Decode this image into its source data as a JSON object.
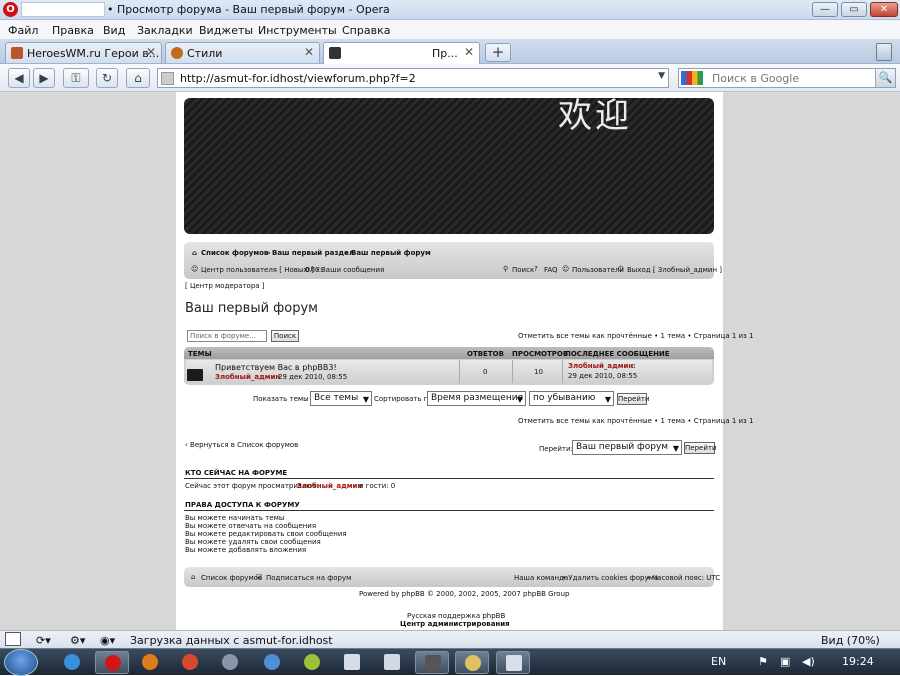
{
  "window": {
    "title": "• Просмотр форума - Ваш первый форум - Opera",
    "opera_badge": "O",
    "min": "—",
    "max": "▭",
    "close": "✕"
  },
  "menu": [
    "Файл",
    "Правка",
    "Вид",
    "Закладки",
    "Виджеты",
    "Инструменты",
    "Справка"
  ],
  "tabs": [
    {
      "label": "HeroesWM.ru Герои в...",
      "close": "✕",
      "icon_color": "#b8572a"
    },
    {
      "label": "Стили",
      "close": "✕",
      "icon_color": "#c46a1b"
    },
    {
      "label": "Пр...",
      "close": "✕",
      "icon_color": "#333333"
    }
  ],
  "newtab": "+",
  "nav": {
    "back": "◀",
    "forward": "▶",
    "key": "⚿",
    "reload": "↻",
    "home": "⌂"
  },
  "address": {
    "url": "http://asmut-for.idhost/viewforum.php?f=2",
    "dropdown": "▼"
  },
  "search": {
    "placeholder": "Поиск в Google",
    "go": "🔍"
  },
  "banner": {
    "text": "欢迎"
  },
  "breadcrumb": {
    "root": "Список форумов",
    "sep1": "»",
    "section": "Ваш первый раздел",
    "sep2": "»",
    "forum": "Ваш первый форум"
  },
  "userbar": {
    "ucp": "Центр пользователя [ Новых ЛС:",
    "pm_count": "0",
    "ucp_end": "] •",
    "messages": "Ваши сообщения",
    "search": "Поиск",
    "faq": "FAQ",
    "members": "Пользователи",
    "logout": "Выход [ Злобный_админ ]"
  },
  "mod_center": "[ Центр модератора ]",
  "forum_title": "Ваш первый форум",
  "forum_search": {
    "placeholder": "Поиск в форуме...",
    "button": "Поиск"
  },
  "pagination_top": "Отметить все темы как прочтённые • 1 тема • Страница 1 из 1",
  "table": {
    "headers": [
      "ТЕМЫ",
      "ОТВЕТОВ",
      "ПРОСМОТРОВ",
      "ПОСЛЕДНЕЕ СООБЩЕНИЕ"
    ],
    "topic": {
      "title": "Приветствуем Вас в phpBB3!",
      "author": "Злобный_админ",
      "date": "29 дек 2010, 08:55",
      "replies": "0",
      "views": "10",
      "last_author": "Злобный_админ",
      "last_date": "29 дек 2010, 08:55"
    }
  },
  "sort": {
    "show_label": "Показать темы за:",
    "show_value": "Все темы",
    "sort_label": "Сортировать по:",
    "sort_value": "Время размещения",
    "order_value": "по убыванию",
    "go": "Перейти"
  },
  "pagination_bottom": "Отметить все темы как прочтённые • 1 тема • Страница 1 из 1",
  "return_link": "‹ Вернуться в Список форумов",
  "jump": {
    "label": "Перейти:",
    "value": "Ваш первый форум",
    "go": "Перейти"
  },
  "who": {
    "heading": "КТО СЕЙЧАС НА ФОРУМЕ",
    "prefix": "Сейчас этот форум просматривают:",
    "user": "Злобный_админ",
    "suffix": "и гости: 0"
  },
  "perms": {
    "heading": "ПРАВА ДОСТУПА К ФОРУМУ",
    "items": [
      "Вы можете начинать темы",
      "Вы можете отвечать на сообщения",
      "Вы можете редактировать свои сообщения",
      "Вы можете удалять свои сообщения",
      "Вы можете добавлять вложения"
    ]
  },
  "footerbar": {
    "root": "Список форумов",
    "subscribe": "Подписаться на форум",
    "team": "Наша команда",
    "delete_cookies": "• Удалить cookies форума",
    "tz": "• Часовой пояс: UTC"
  },
  "powered": "Powered by phpBB © 2000, 2002, 2005, 2007 phpBB Group",
  "support": "Русская поддержка phpBB",
  "admin": "Центр администрирования",
  "status": {
    "loading": "Загрузка данных с asmut-for.idhost",
    "zoom": "Вид (70%)"
  },
  "taskbar": {
    "lang": "EN",
    "time": "19:24"
  }
}
